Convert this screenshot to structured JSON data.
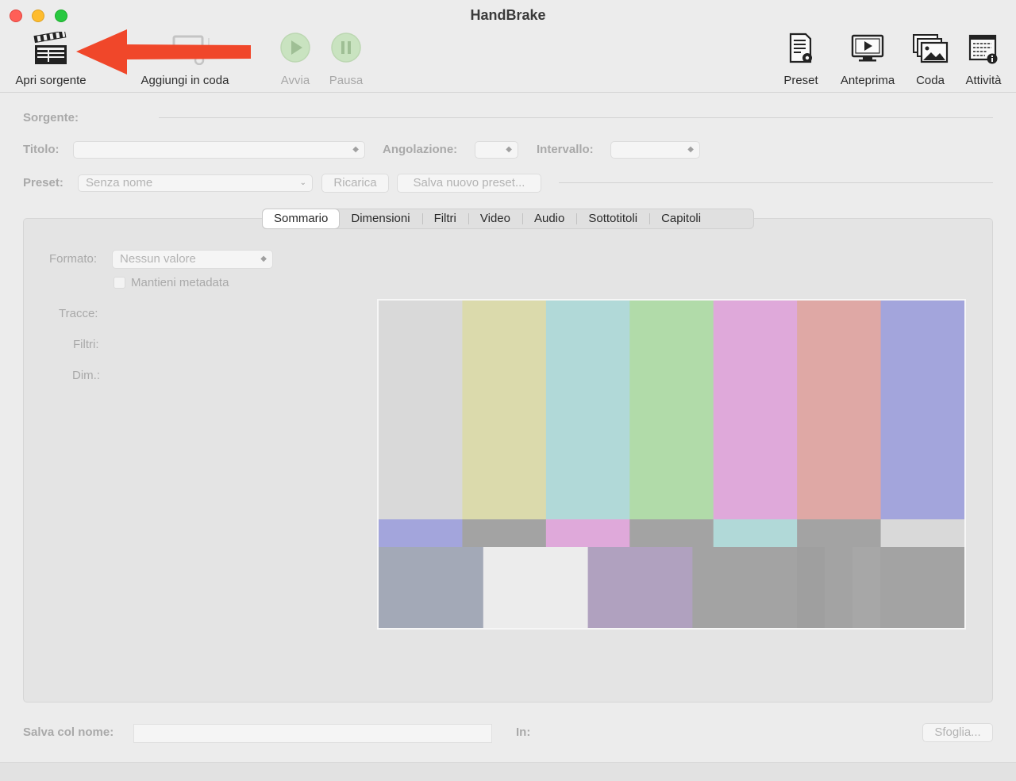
{
  "window": {
    "title": "HandBrake"
  },
  "toolbar": {
    "open_source": "Apri sorgente",
    "add_to_queue": "Aggiungi in coda",
    "start": "Avvia",
    "pause": "Pausa",
    "presets": "Preset",
    "preview": "Anteprima",
    "queue": "Coda",
    "activity": "Attività"
  },
  "source": {
    "label": "Sorgente:"
  },
  "title_row": {
    "title_label": "Titolo:",
    "title_value": "",
    "angle_label": "Angolazione:",
    "angle_value": "",
    "range_label": "Intervallo:",
    "range_value": ""
  },
  "preset_row": {
    "label": "Preset:",
    "selected": "Senza nome",
    "reload": "Ricarica",
    "save_new": "Salva nuovo preset..."
  },
  "tabs": [
    "Sommario",
    "Dimensioni",
    "Filtri",
    "Video",
    "Audio",
    "Sottotitoli",
    "Capitoli"
  ],
  "summary": {
    "format_label": "Formato:",
    "format_value": "Nessun valore",
    "keep_metadata": "Mantieni metadata",
    "tracks_label": "Tracce:",
    "filters_label": "Filtri:",
    "dimensions_label": "Dim.:"
  },
  "bottom": {
    "save_as_label": "Salva col nome:",
    "save_as_value": "",
    "in_label": "In:",
    "browse": "Sfoglia..."
  },
  "colors": {
    "arrow": "#f0472a",
    "bars_top": [
      "#d9d9d9",
      "#dbdaac",
      "#b1d9d8",
      "#b1dba9",
      "#dfa9da",
      "#dfa8a5",
      "#a3a5dc"
    ],
    "bars_mid": [
      "#a3a5dc",
      "#a3a3a3",
      "#dfa9da",
      "#a3a3a3",
      "#b1d9d8",
      "#a3a3a3",
      "#d9d9d9"
    ],
    "bars_bottom": [
      "#a3a9b7",
      "#ececec",
      "#b0a1bf",
      "#a3a3a3",
      "#a3a3a3"
    ]
  }
}
